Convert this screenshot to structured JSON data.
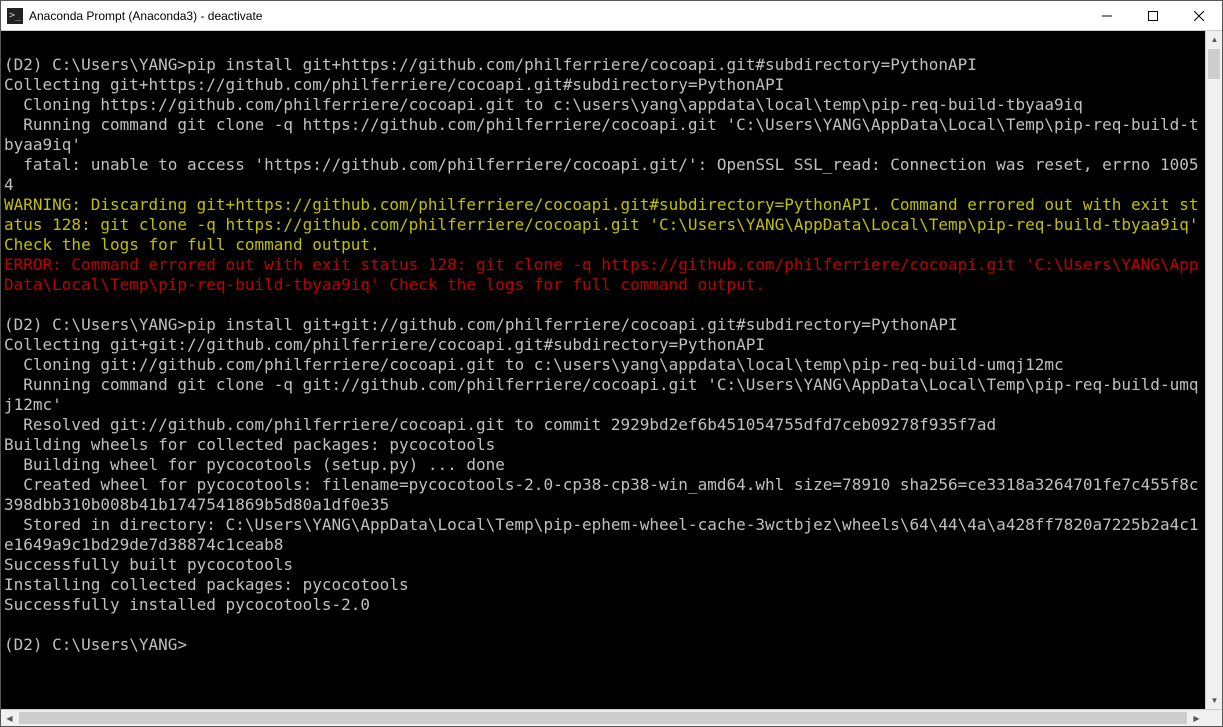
{
  "window": {
    "title": "Anaconda Prompt (Anaconda3) - deactivate"
  },
  "terminal": {
    "lines": [
      {
        "cls": "",
        "text": ""
      },
      {
        "cls": "",
        "text": "(D2) C:\\Users\\YANG>pip install git+https://github.com/philferriere/cocoapi.git#subdirectory=PythonAPI"
      },
      {
        "cls": "",
        "text": "Collecting git+https://github.com/philferriere/cocoapi.git#subdirectory=PythonAPI"
      },
      {
        "cls": "",
        "text": "  Cloning https://github.com/philferriere/cocoapi.git to c:\\users\\yang\\appdata\\local\\temp\\pip-req-build-tbyaa9iq"
      },
      {
        "cls": "",
        "text": "  Running command git clone -q https://github.com/philferriere/cocoapi.git 'C:\\Users\\YANG\\AppData\\Local\\Temp\\pip-req-build-tbyaa9iq'"
      },
      {
        "cls": "",
        "text": "  fatal: unable to access 'https://github.com/philferriere/cocoapi.git/': OpenSSL SSL_read: Connection was reset, errno 10054"
      },
      {
        "cls": "warn",
        "text": "WARNING: Discarding git+https://github.com/philferriere/cocoapi.git#subdirectory=PythonAPI. Command errored out with exit status 128: git clone -q https://github.com/philferriere/cocoapi.git 'C:\\Users\\YANG\\AppData\\Local\\Temp\\pip-req-build-tbyaa9iq' Check the logs for full command output."
      },
      {
        "cls": "err",
        "text": "ERROR: Command errored out with exit status 128: git clone -q https://github.com/philferriere/cocoapi.git 'C:\\Users\\YANG\\AppData\\Local\\Temp\\pip-req-build-tbyaa9iq' Check the logs for full command output."
      },
      {
        "cls": "",
        "text": ""
      },
      {
        "cls": "",
        "text": "(D2) C:\\Users\\YANG>pip install git+git://github.com/philferriere/cocoapi.git#subdirectory=PythonAPI"
      },
      {
        "cls": "",
        "text": "Collecting git+git://github.com/philferriere/cocoapi.git#subdirectory=PythonAPI"
      },
      {
        "cls": "",
        "text": "  Cloning git://github.com/philferriere/cocoapi.git to c:\\users\\yang\\appdata\\local\\temp\\pip-req-build-umqj12mc"
      },
      {
        "cls": "",
        "text": "  Running command git clone -q git://github.com/philferriere/cocoapi.git 'C:\\Users\\YANG\\AppData\\Local\\Temp\\pip-req-build-umqj12mc'"
      },
      {
        "cls": "",
        "text": "  Resolved git://github.com/philferriere/cocoapi.git to commit 2929bd2ef6b451054755dfd7ceb09278f935f7ad"
      },
      {
        "cls": "",
        "text": "Building wheels for collected packages: pycocotools"
      },
      {
        "cls": "",
        "text": "  Building wheel for pycocotools (setup.py) ... done"
      },
      {
        "cls": "",
        "text": "  Created wheel for pycocotools: filename=pycocotools-2.0-cp38-cp38-win_amd64.whl size=78910 sha256=ce3318a3264701fe7c455f8c398dbb310b008b41b1747541869b5d80a1df0e35"
      },
      {
        "cls": "",
        "text": "  Stored in directory: C:\\Users\\YANG\\AppData\\Local\\Temp\\pip-ephem-wheel-cache-3wctbjez\\wheels\\64\\44\\4a\\a428ff7820a7225b2a4c1e1649a9c1bd29de7d38874c1ceab8"
      },
      {
        "cls": "",
        "text": "Successfully built pycocotools"
      },
      {
        "cls": "",
        "text": "Installing collected packages: pycocotools"
      },
      {
        "cls": "",
        "text": "Successfully installed pycocotools-2.0"
      },
      {
        "cls": "",
        "text": ""
      },
      {
        "cls": "",
        "text": "(D2) C:\\Users\\YANG>"
      }
    ]
  }
}
